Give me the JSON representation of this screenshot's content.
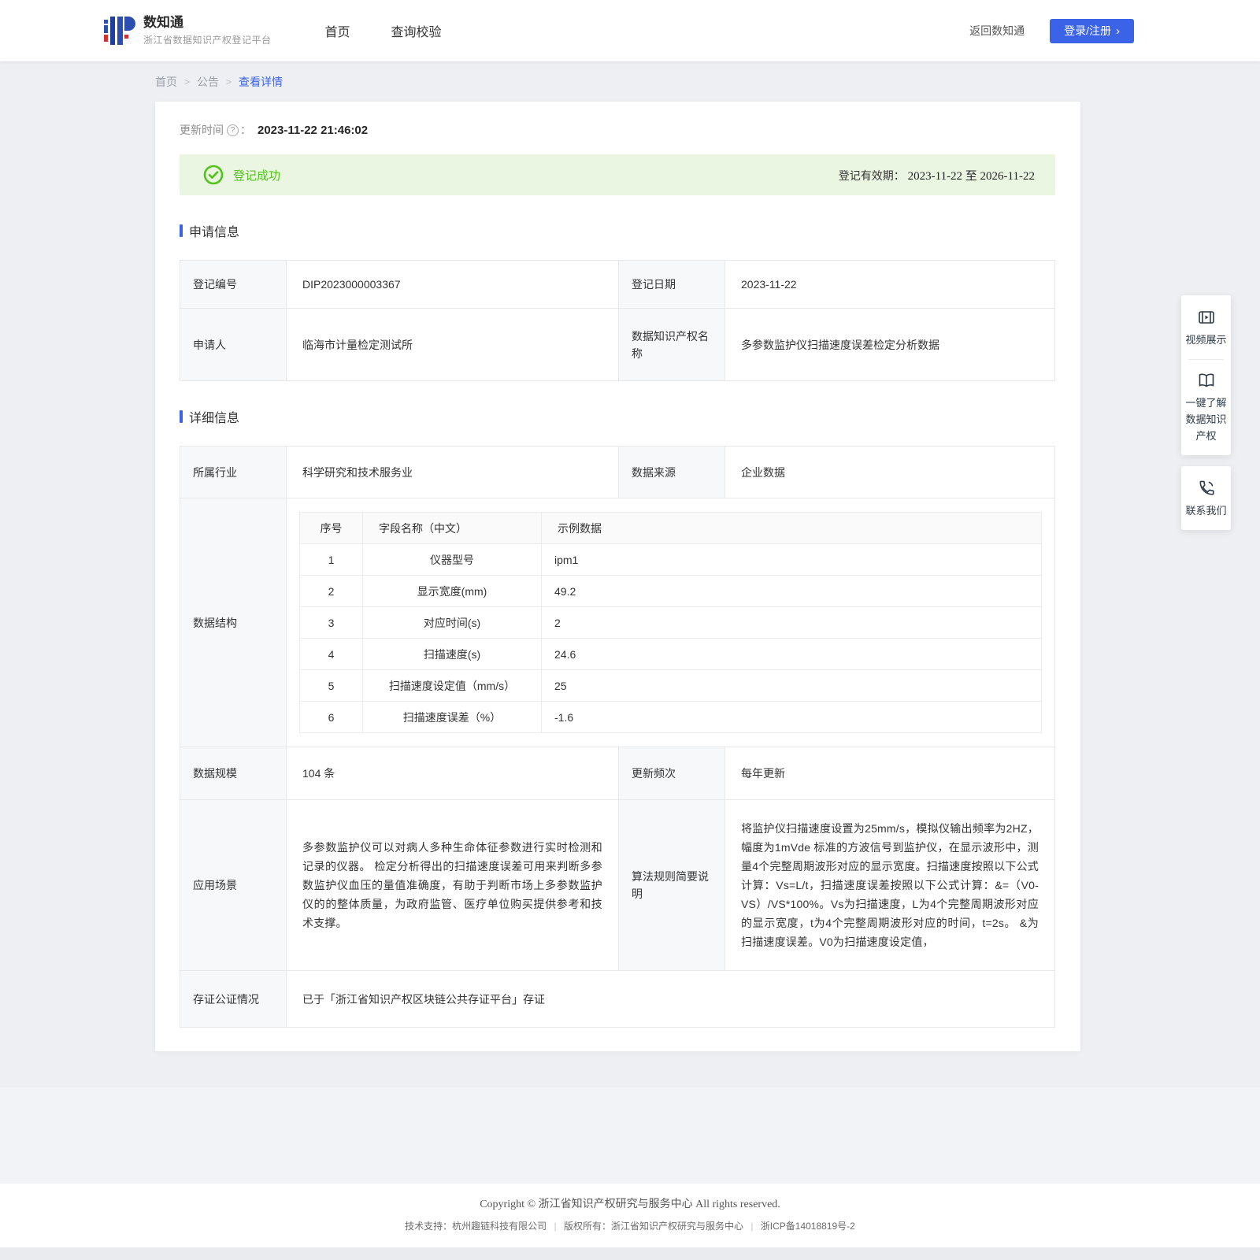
{
  "colors": {
    "accent": "#3b63e8",
    "success": "#52c41a",
    "success_bg": "#eaf5e2",
    "button": "#3b63e8"
  },
  "icons": {
    "help": "?",
    "chevron": "›"
  },
  "header": {
    "logo_title": "数知通",
    "logo_subtitle": "浙江省数据知识产权登记平台",
    "nav": [
      "首页",
      "查询校验"
    ],
    "back_link": "返回数知通",
    "login_button": "登录/注册"
  },
  "breadcrumb": {
    "home": "首页",
    "announcement": "公告",
    "current": "查看详情",
    "sep": ">"
  },
  "update": {
    "label": "更新时间",
    "colon": "：",
    "value": "2023-11-22 21:46:02"
  },
  "banner": {
    "status": "登记成功",
    "validity_label": "登记有效期：",
    "validity_value": "2023-11-22 至 2026-11-22"
  },
  "sections": {
    "apply": "申请信息",
    "detail": "详细信息"
  },
  "apply_table": {
    "reg_no_label": "登记编号",
    "reg_no": "DIP2023000003367",
    "reg_date_label": "登记日期",
    "reg_date": "2023-11-22",
    "applicant_label": "申请人",
    "applicant": "临海市计量检定测试所",
    "dip_name_label": "数据知识产权名称",
    "dip_name": "多参数监护仪扫描速度误差检定分析数据"
  },
  "detail_table": {
    "industry_label": "所属行业",
    "industry": "科学研究和技术服务业",
    "source_label": "数据来源",
    "source": "企业数据",
    "structure_label": "数据结构",
    "scale_label": "数据规模",
    "scale": "104 条",
    "freq_label": "更新频次",
    "freq": "每年更新",
    "scene_label": "应用场景",
    "scene": "多参数监护仪可以对病人多种生命体征参数进行实时检测和记录的仪器。 检定分析得出的扫描速度误差可用来判断多参数监护仪血压的量值准确度，有助于判断市场上多参数监护仪的的整体质量，为政府监管、医疗单位购买提供参考和技术支撑。",
    "algo_label": "算法规则简要说明",
    "algo": "将监护仪扫描速度设置为25mm/s，模拟仪输出频率为2HZ，幅度为1mVde 标准的方波信号到监护仪，在显示波形中，测量4个完整周期波形对应的显示宽度。扫描速度按照以下公式计算：Vs=L/t，扫描速度误差按照以下公式计算：&=（V0-VS）/VS*100%。Vs为扫描速度，L为4个完整周期波形对应的显示宽度，t为4个完整周期波形对应的时间，t=2s。 &为扫描速度误差。V0为扫描速度设定值，",
    "evidence_label": "存证公证情况",
    "evidence": "已于「浙江省知识产权区块链公共存证平台」存证"
  },
  "structure_table": {
    "headers": {
      "no": "序号",
      "field": "字段名称（中文）",
      "sample": "示例数据"
    },
    "rows": [
      {
        "no": "1",
        "field": "仪器型号",
        "sample": "ipm1"
      },
      {
        "no": "2",
        "field": "显示宽度(mm)",
        "sample": "49.2"
      },
      {
        "no": "3",
        "field": "对应时间(s)",
        "sample": "2"
      },
      {
        "no": "4",
        "field": "扫描速度(s)",
        "sample": "24.6"
      },
      {
        "no": "5",
        "field": "扫描速度设定值（mm/s）",
        "sample": "25"
      },
      {
        "no": "6",
        "field": "扫描速度误差（%）",
        "sample": "-1.6"
      }
    ]
  },
  "side_widgets": {
    "video": "视频展示",
    "guide": "一键了解数据知识产权",
    "contact": "联系我们"
  },
  "footer": {
    "copyright": "Copyright © 浙江省知识产权研究与服务中心 All rights reserved.",
    "support": "技术支持：杭州趣链科技有限公司",
    "owner": "版权所有：浙江省知识产权研究与服务中心",
    "icp": "浙ICP备14018819号-2",
    "pipe": "|"
  }
}
